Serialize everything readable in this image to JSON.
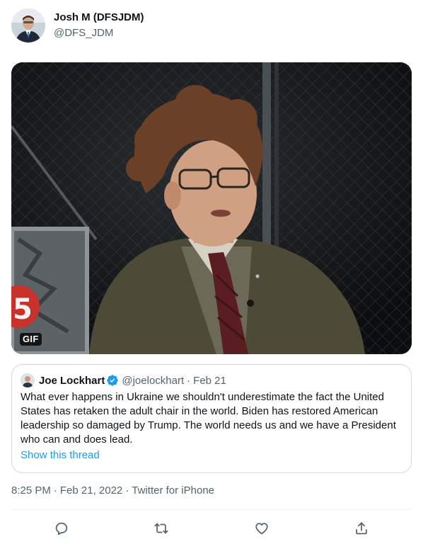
{
  "tweet": {
    "author_name": "Josh M (DFSJDM)",
    "author_handle": "@DFS_JDM",
    "media": {
      "badge": "GIF"
    },
    "quoted": {
      "author_name": "Joe Lockhart",
      "author_handle": "@joelockhart",
      "separator": "·",
      "date": "Feb 21",
      "text": "What ever happens in Ukraine we shouldn't underestimate the fact the United States has retaken the adult chair in the world. Biden has restored American leadership so damaged by Trump. The world needs us and we have a President who can and does lead.",
      "show_thread": "Show this thread"
    },
    "time": "8:25 PM",
    "separator": "·",
    "date": "Feb 21, 2022",
    "source": "Twitter for iPhone"
  },
  "actions": {
    "reply_icon": "reply-icon",
    "retweet_icon": "retweet-icon",
    "like_icon": "like-icon",
    "share_icon": "share-icon"
  },
  "colors": {
    "accent": "#1d9bf0",
    "secondary_text": "#536471",
    "border": "#cfd9de"
  }
}
